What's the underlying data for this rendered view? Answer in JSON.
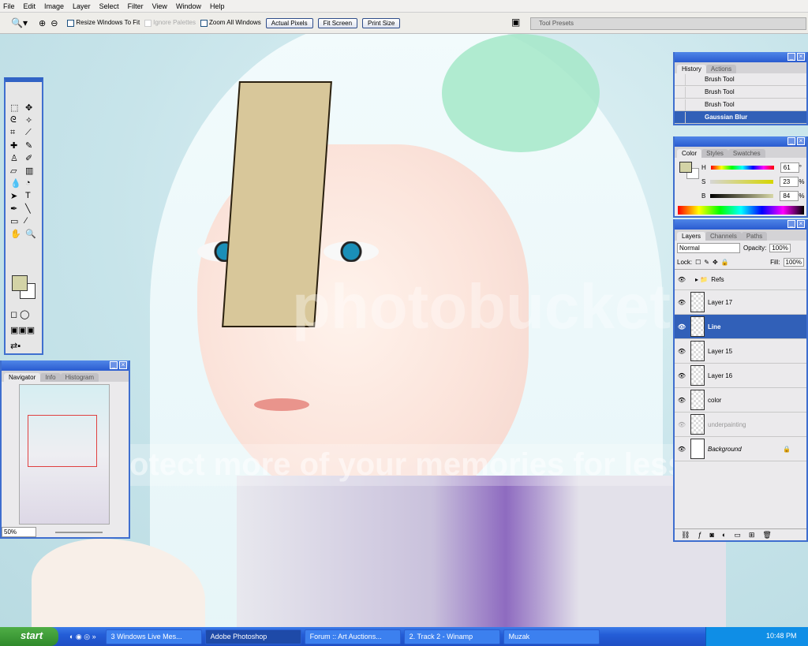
{
  "menu": [
    "File",
    "Edit",
    "Image",
    "Layer",
    "Select",
    "Filter",
    "View",
    "Window",
    "Help"
  ],
  "options": {
    "resize": "Resize Windows To Fit",
    "ignore": "Ignore Palettes",
    "zoomall": "Zoom All Windows",
    "actual": "Actual Pixels",
    "fit": "Fit Screen",
    "print": "Print Size",
    "presets": "Tool Presets"
  },
  "watermark": {
    "logo": "photobucket",
    "tagline": "protect more of your memories for less!"
  },
  "navigator": {
    "tabs": [
      "Navigator",
      "Info",
      "Histogram"
    ],
    "zoom": "50%"
  },
  "history": {
    "tabs": [
      "History",
      "Actions"
    ],
    "items": [
      "Brush Tool",
      "Brush Tool",
      "Brush Tool",
      "Gaussian Blur"
    ]
  },
  "color": {
    "tabs": [
      "Color",
      "Styles",
      "Swatches"
    ],
    "h_label": "H",
    "s_label": "S",
    "b_label": "B",
    "h": "61",
    "s": "23",
    "b": "84",
    "h_unit": "°",
    "s_unit": "%",
    "b_unit": "%",
    "foreground": "#d3d3a6",
    "background": "#ffffff"
  },
  "layers": {
    "tabs": [
      "Layers",
      "Channels",
      "Paths"
    ],
    "blend": "Normal",
    "opacity_label": "Opacity:",
    "opacity": "100%",
    "lock_label": "Lock:",
    "fill_label": "Fill:",
    "fill": "100%",
    "items": [
      {
        "name": "Refs",
        "type": "group"
      },
      {
        "name": "Layer 17"
      },
      {
        "name": "Line",
        "selected": true
      },
      {
        "name": "Layer 15"
      },
      {
        "name": "Layer 16"
      },
      {
        "name": "color"
      },
      {
        "name": "underpainting",
        "hidden": true
      },
      {
        "name": "Background",
        "locked": true
      }
    ]
  },
  "taskbar": {
    "start": "start",
    "tasks": [
      "3 Windows Live Mes...",
      "Adobe Photoshop",
      "Forum :: Art Auctions...",
      "2. Track 2 - Winamp",
      "Muzak"
    ],
    "clock": "10:48 PM"
  }
}
